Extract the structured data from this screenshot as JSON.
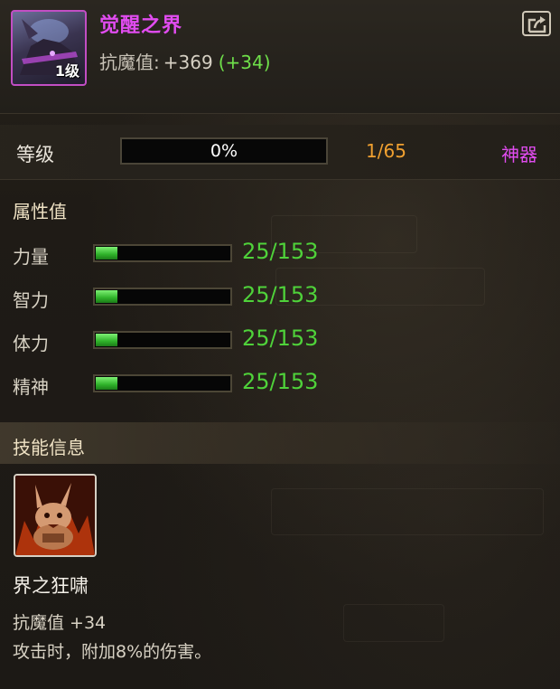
{
  "item": {
    "name": "觉醒之界",
    "level_badge": "1级",
    "resist_label": "抗魔值:",
    "resist_value": "+369",
    "resist_bonus": "(+34)"
  },
  "level": {
    "label": "等级",
    "progress_text": "0%",
    "progress": 0,
    "count": "1/65",
    "tag": "神器"
  },
  "attributes": {
    "title": "属性值",
    "items": [
      {
        "name": "力量",
        "value": "25/153",
        "fill": 0.163
      },
      {
        "name": "智力",
        "value": "25/153",
        "fill": 0.163
      },
      {
        "name": "体力",
        "value": "25/153",
        "fill": 0.163
      },
      {
        "name": "精神",
        "value": "25/153",
        "fill": 0.163
      }
    ]
  },
  "skill": {
    "title": "技能信息",
    "name": "界之狂啸",
    "effect": "抗魔值 +34",
    "description": "攻击时，附加8%的伤害。"
  },
  "colors": {
    "item_name": "#e14cf0",
    "bonus_green": "#6fe04a",
    "level_count": "#f0a030",
    "attr_value": "#4fd23a"
  },
  "icons": {
    "export": "export-arrow-icon",
    "item": "awakening-item-icon",
    "skill": "rabbit-skill-icon"
  }
}
